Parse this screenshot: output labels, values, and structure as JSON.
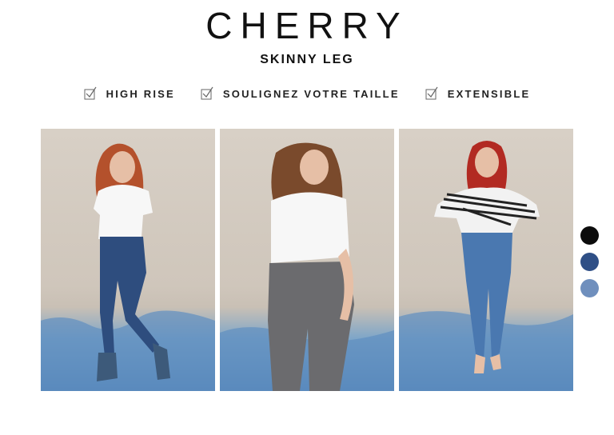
{
  "header": {
    "title": "CHERRY",
    "subtitle": "SKINNY LEG"
  },
  "features": [
    {
      "label": "HIGH RISE",
      "icon": "checkbox-icon"
    },
    {
      "label": "SOULIGNEZ VOTRE TAILLE",
      "icon": "checkbox-icon"
    },
    {
      "label": "EXTENSIBLE",
      "icon": "checkbox-icon"
    }
  ],
  "photos": [
    {
      "subject": "model-side-view-dark-jeans"
    },
    {
      "subject": "model-back-view-grey-jeans"
    },
    {
      "subject": "model-front-view-blue-jeans"
    }
  ],
  "color_swatches": [
    {
      "color": "#0c0c0c",
      "name": "black"
    },
    {
      "color": "#2f4f86",
      "name": "dark-blue"
    },
    {
      "color": "#6f8fbd",
      "name": "light-blue"
    }
  ]
}
